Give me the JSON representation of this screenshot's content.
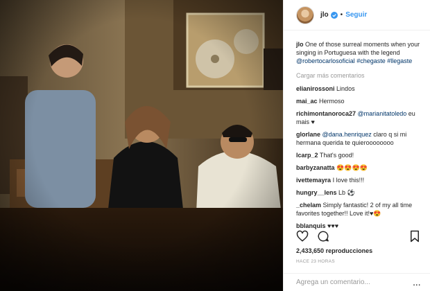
{
  "header": {
    "username": "jlo",
    "follow_label": "Seguir"
  },
  "caption": {
    "username": "jlo",
    "text": "One of those surreal moments when your singing in Portuguesa with the legend",
    "mention": "@robertocarlosoficial",
    "hashtags": "#chegaste #llegaste"
  },
  "load_more": "Cargar más comentarios",
  "comments": [
    {
      "user": "elianirossoni",
      "text": "Lindos"
    },
    {
      "user": "mai_ac",
      "text": "Hermoso"
    },
    {
      "user": "richimontanoroca27",
      "mention": "@marianitatoledo",
      "text": "eu mais ♥"
    },
    {
      "user": "glorlane",
      "mention": "@dana.henriquez",
      "text": "claro q si mi hermana querida te quieroooooooo"
    },
    {
      "user": "lcarp_2",
      "text": "That's good!"
    },
    {
      "user": "barbyzanatta",
      "text": "😍😍😍😍"
    },
    {
      "user": "ivettemayra",
      "text": "I love this!!!"
    },
    {
      "user": "hungry__lens",
      "text": "Lb ⚽"
    },
    {
      "user": "_chelam",
      "text": "Simply fantastic! 2 of my all time favorites together!! Love it!♥😍"
    },
    {
      "user": "bblanquis",
      "text": "♥♥♥"
    }
  ],
  "stats": {
    "views": "2,433,650",
    "views_label": "reproducciones",
    "time_ago": "HACE 23 HORAS"
  },
  "add_comment": {
    "placeholder": "Agrega un comentario...",
    "more": "..."
  },
  "icons": {
    "verified": "verified-badge-icon",
    "like": "heart-icon",
    "comment": "speech-bubble-icon",
    "save": "bookmark-icon"
  },
  "colors": {
    "link": "#003569",
    "follow": "#3897f0",
    "muted": "#999999",
    "verified": "#3897f0"
  }
}
